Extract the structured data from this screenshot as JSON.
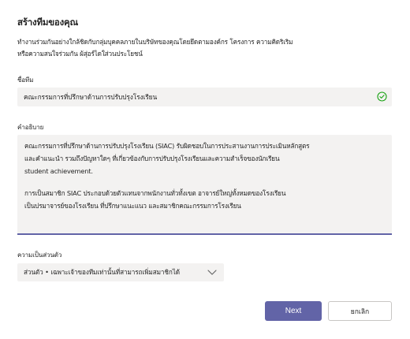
{
  "dialog": {
    "title": "สร้างทีมของคุณ",
    "description_line1": "ทำงานร่วมกันอย่างใกล้ชิดกับกลุ่มบุคคลภายในบริษัทของคุณโดยยึดตามองค์กร โครงการ ความคิดริเริม",
    "description_line2": "หรือความสนใจร่วมกัน ผ้สุ่อร์ไดใส่วนประโยชน์"
  },
  "team_name": {
    "label": "ชื่อทีม",
    "value": "คณะกรรมการที่ปรึกษาด้านการปรับปรุงโรงเรียน",
    "valid_icon": "check-circle-icon",
    "valid_color": "#13a10e"
  },
  "team_description": {
    "label": "คำอธิบาย",
    "line1": "คณะกรรมการที่ปรึกษาด้านการปรับปรุงโรงเรียน (SIAC) รับผิดชอบในการประสานงานการประเมินหลักสูตร",
    "line2": "และคำแนะนำ รวมถึงปัญหาใดๆ ที่เกี่ยวข้องกับการปรับปรุงโรงเรียนและความสำเร็จของนักเรียน",
    "line3": "student achievement.",
    "line4": "การเป็นสมาชิก SIAC ประกอบด้วยตัวแทนจากพนักงานทั่วทั้งเขต อาจารย์ใหญ่ทั้งหมดของโรงเรียน",
    "line5": "เป็นปรมาจารย์ของโรงเรียน ที่ปรึกษาแนะแนว และสมาชิกคณะกรรมการโรงเรียน"
  },
  "privacy": {
    "label": "ความเป็นส่วนตัว",
    "selected": "ส่วนตัว • เฉพาะเจ้าของทีมเท่านั้นที่สามารถเพิ่มสมาชิกได้",
    "dropdown_icon": "chevron-down-icon"
  },
  "actions": {
    "next_label": "Next",
    "cancel_label": "ยกเลิก",
    "accent_color": "#6264a7"
  }
}
